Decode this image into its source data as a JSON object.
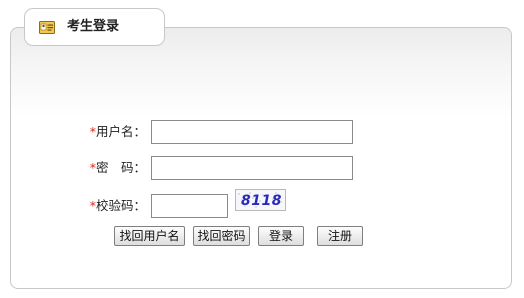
{
  "header": {
    "title": "考生登录",
    "icon": "id-card-icon"
  },
  "form": {
    "required_mark": "*",
    "username_label": "用户名：",
    "password_label": "密　码：",
    "captcha_label": "校验码：",
    "username_value": "",
    "password_value": "",
    "captcha_value": "",
    "captcha_text": "8118"
  },
  "buttons": {
    "find_username": "找回用户名",
    "find_password": "找回密码",
    "login": "登录",
    "register": "注册"
  },
  "colors": {
    "required": "#e0261b",
    "captcha_digits": "#2b2ab8"
  }
}
